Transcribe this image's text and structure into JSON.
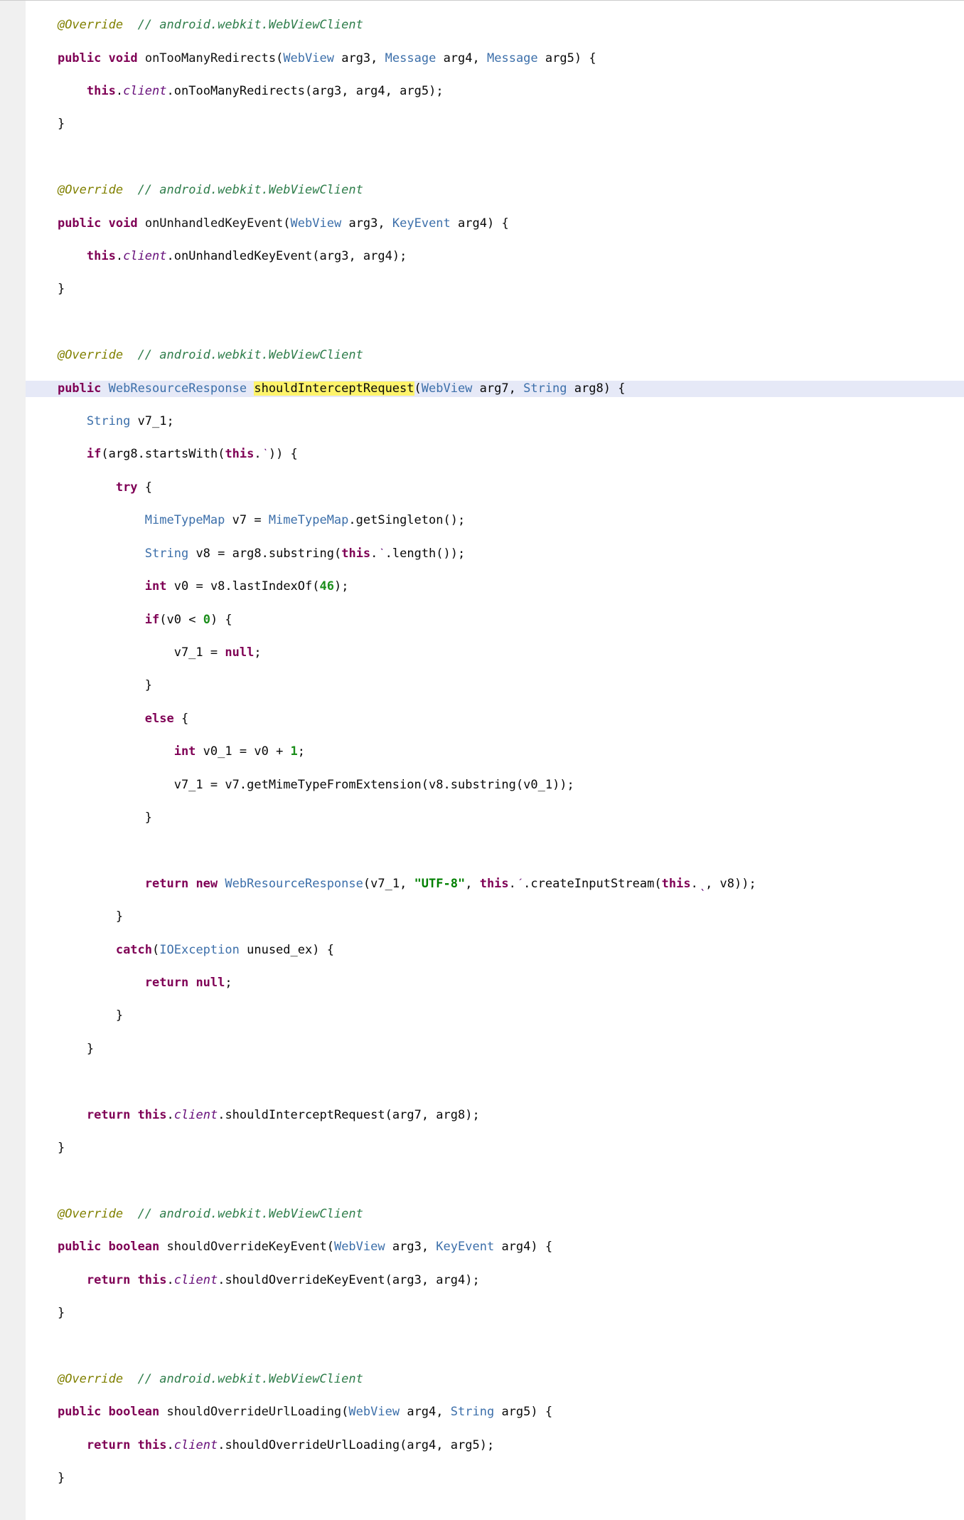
{
  "tokens": {
    "ann_override": "@Override",
    "cmt_wvc": "// android.webkit.WebViewClient",
    "kw_public": "public",
    "kw_void": "void",
    "kw_boolean": "boolean",
    "kw_this": "this",
    "kw_if": "if",
    "kw_else": "else",
    "kw_try": "try",
    "kw_catch": "catch",
    "kw_return": "return",
    "kw_new": "new",
    "kw_null": "null",
    "kw_int": "int",
    "typ_WebView": "WebView",
    "typ_Message": "Message",
    "typ_KeyEvent": "KeyEvent",
    "typ_String": "String",
    "typ_WebResourceResponse": "WebResourceResponse",
    "typ_MimeTypeMap": "MimeTypeMap",
    "typ_IOException": "IOException",
    "fld_client": "client",
    "fn_onTooManyRedirects": "onTooManyRedirects",
    "fn_onUnhandledKeyEvent": "onUnhandledKeyEvent",
    "fn_shouldInterceptRequest": "shouldInterceptRequest",
    "fn_shouldOverrideKeyEvent": "shouldOverrideKeyEvent",
    "fn_shouldOverrideUrlLoading": "shouldOverrideUrlLoading",
    "fn_startsWith": "startsWith",
    "fn_getSingleton": "getSingleton",
    "fn_substring": "substring",
    "fn_length": "length",
    "fn_lastIndexOf": "lastIndexOf",
    "fn_getMimeTypeFromExtension": "getMimeTypeFromExtension",
    "fn_createInputStream": "createInputStream",
    "id_arg3": "arg3",
    "id_arg4": "arg4",
    "id_arg5": "arg5",
    "id_arg7": "arg7",
    "id_arg8": "arg8",
    "id_v7": "v7",
    "id_v7_1": "v7_1",
    "id_v8": "v8",
    "id_v0": "v0",
    "id_v0_1": "v0_1",
    "id_unused_ex": "unused_ex",
    "num_46": "46",
    "num_0": "0",
    "num_1": "1",
    "str_utf8": "\"UTF-8\"",
    "obf_backtick": "ˋ",
    "obf_acute": "ˊ",
    "obf_low": "ˎ"
  }
}
